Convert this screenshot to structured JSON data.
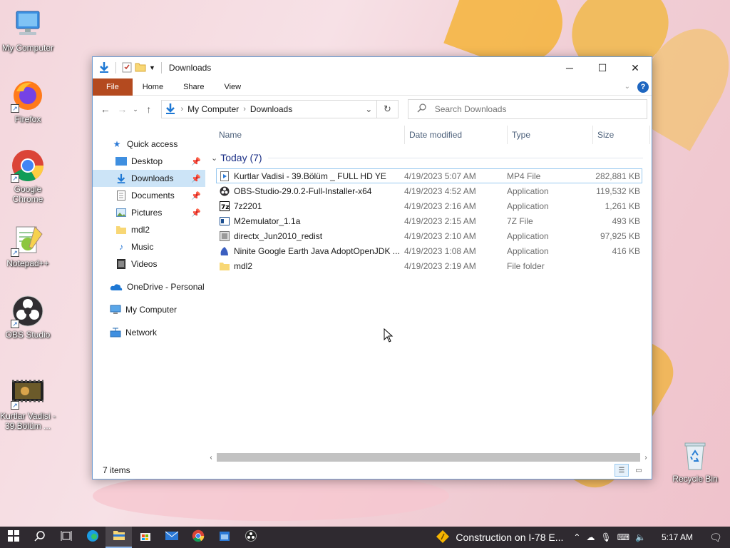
{
  "desktop": {
    "icons": [
      {
        "label": "My Computer"
      },
      {
        "label": "Firefox"
      },
      {
        "label": "Google Chrome"
      },
      {
        "label": "Notepad++"
      },
      {
        "label": "OBS Studio"
      },
      {
        "label": "Kurtlar Vadisi - 39.Bölüm ..."
      },
      {
        "label": "Recycle Bin"
      }
    ]
  },
  "window": {
    "title": "Downloads",
    "ribbon_tabs": [
      "File",
      "Home",
      "Share",
      "View"
    ],
    "help_label": "?",
    "address": {
      "root": "My Computer",
      "current": "Downloads"
    },
    "search": {
      "placeholder": "Search Downloads"
    },
    "nav": {
      "quick_access": "Quick access",
      "items": [
        {
          "label": "Desktop",
          "pinned": true
        },
        {
          "label": "Downloads",
          "pinned": true,
          "selected": true
        },
        {
          "label": "Documents",
          "pinned": true
        },
        {
          "label": "Pictures",
          "pinned": true
        },
        {
          "label": "mdl2"
        },
        {
          "label": "Music"
        },
        {
          "label": "Videos"
        }
      ],
      "onedrive": "OneDrive - Personal",
      "my_computer": "My Computer",
      "network": "Network"
    },
    "columns": {
      "name": "Name",
      "date": "Date modified",
      "type": "Type",
      "size": "Size"
    },
    "group_label": "Today (7)",
    "files": [
      {
        "name": "Kurtlar Vadisi - 39.Bölüm _ FULL HD YE",
        "date": "4/19/2023 5:07 AM",
        "type": "MP4 File",
        "size": "282,881 KB",
        "icon": "video-file-icon"
      },
      {
        "name": "OBS-Studio-29.0.2-Full-Installer-x64",
        "date": "4/19/2023 4:52 AM",
        "type": "Application",
        "size": "119,532 KB",
        "icon": "obs-installer-icon"
      },
      {
        "name": "7z2201",
        "date": "4/19/2023 2:16 AM",
        "type": "Application",
        "size": "1,261 KB",
        "icon": "7zip-icon"
      },
      {
        "name": "M2emulator_1.1a",
        "date": "4/19/2023 2:15 AM",
        "type": "7Z File",
        "size": "493 KB",
        "icon": "archive-icon"
      },
      {
        "name": "directx_Jun2010_redist",
        "date": "4/19/2023 2:10 AM",
        "type": "Application",
        "size": "97,925 KB",
        "icon": "installer-icon"
      },
      {
        "name": "Ninite Google Earth Java AdoptOpenJDK ...",
        "date": "4/19/2023 1:08 AM",
        "type": "Application",
        "size": "416 KB",
        "icon": "ninite-icon"
      },
      {
        "name": "mdl2",
        "date": "4/19/2023 2:19 AM",
        "type": "File folder",
        "size": "",
        "icon": "folder-icon"
      }
    ],
    "status": "7 items"
  },
  "taskbar": {
    "news": "Construction on I-78 E...",
    "clock": "5:17 AM"
  }
}
